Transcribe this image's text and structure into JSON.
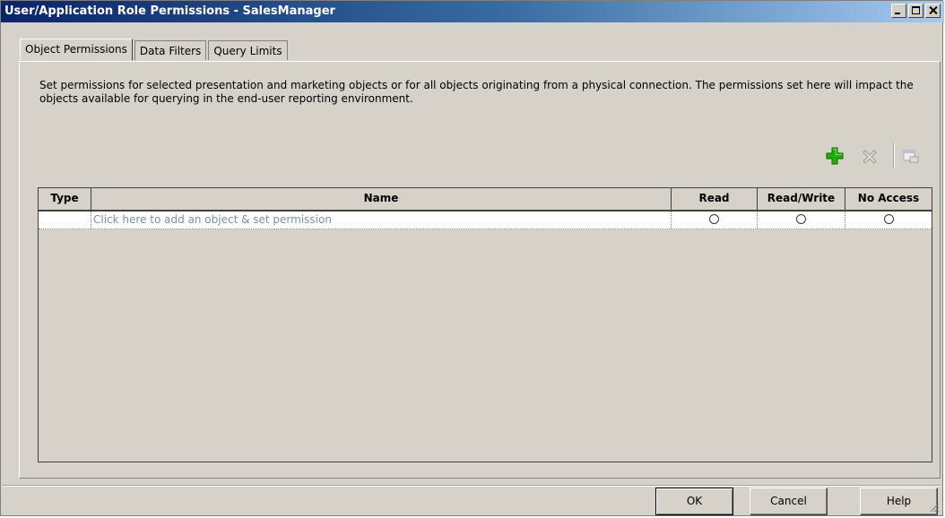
{
  "window": {
    "title": "User/Application Role Permissions - SalesManager"
  },
  "tabs": [
    {
      "label": "Object Permissions",
      "active": true
    },
    {
      "label": "Data Filters",
      "active": false
    },
    {
      "label": "Query Limits",
      "active": false
    }
  ],
  "description": "Set permissions for selected presentation and marketing objects or for all objects originating from a physical connection. The permissions set here will impact the objects available for querying in the end-user reporting environment.",
  "toolbar": {
    "add_icon": "green-plus-icon",
    "delete_icon": "gray-x-icon",
    "properties_icon": "properties-icon"
  },
  "grid": {
    "columns": [
      "Type",
      "Name",
      "Read",
      "Read/Write",
      "No Access"
    ],
    "rows": [
      {
        "type": "",
        "name": "Click here to add an object & set permission"
      }
    ]
  },
  "buttons": {
    "ok": "OK",
    "cancel": "Cancel",
    "help": "Help"
  },
  "colors": {
    "title_bar": "#0a246a",
    "dialog_bg": "#d6d2ca",
    "placeholder_text": "#7a8fa8",
    "add_icon": "#22b000"
  }
}
